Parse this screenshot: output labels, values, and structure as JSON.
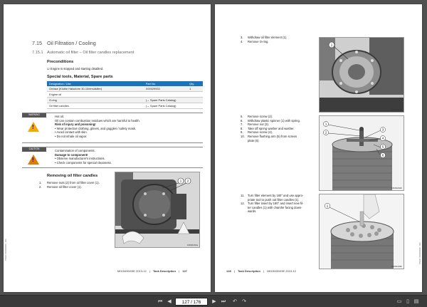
{
  "left_page": {
    "section_number": "7.15",
    "section_title": "Oil Filtration / Cooling",
    "subsection_number": "7.15.1",
    "subsection_title": "Automatic oil filter – Oil filter candles replacement",
    "preconditions_heading": "Preconditions",
    "precondition_item": "☑ Engine is stopped and starting disabled.",
    "tools_heading": "Special tools, Material, Spare parts",
    "tools_table": {
      "headers": [
        "Designation / Use",
        "Part No.",
        "Qty."
      ],
      "rows": [
        [
          "Grease (Kluthe Hakuform 30-10/emulsifier)",
          "X00029933",
          "1"
        ],
        [
          "Engine oil",
          "",
          ""
        ],
        [
          "O-ring",
          "(→ Spare Parts Catalog)",
          ""
        ],
        [
          "Oil filter candles",
          "(→ Spare Parts Catalog)",
          ""
        ]
      ]
    },
    "warning": {
      "tag": "WARNING",
      "lines": [
        "Hot oil.",
        "Oil can contain combustion residues which are harmful to health.",
        "Risk of injury and poisoning!",
        "• Wear protective clothing, gloves, and goggles / safety mask.",
        "• Avoid contact with skin.",
        "• Do not inhale oil vapor."
      ]
    },
    "caution": {
      "tag": "CAUTION",
      "lines": [
        "Contamination of components.",
        "Damage to component!",
        "• Observe manufacturer's instructions.",
        "• Check components for special cleanness."
      ]
    },
    "removing_heading": "Removing oil filter candles",
    "steps": [
      {
        "num": "1.",
        "text": "Remove nuts (2) from oil filter cover (1)."
      },
      {
        "num": "2.",
        "text": "Remove oil filter cover (1)."
      }
    ],
    "photo_callouts": [
      "1",
      "2"
    ],
    "photo_id": "16000191a",
    "footer_doc": "M015490/03E 2013-12",
    "footer_section": "Task Description",
    "footer_page": "127",
    "side_text": "TIM-ID: 0000000000 - 004"
  },
  "right_page": {
    "steps_a": [
      {
        "num": "3.",
        "text": "Withdraw oil filter element (1)."
      },
      {
        "num": "4.",
        "text": "Remove O-ring."
      }
    ],
    "photo_a_callouts": [
      "1"
    ],
    "photo_a_id": "16000192b",
    "steps_b": [
      {
        "num": "5.",
        "text": "Remove screw (2)."
      },
      {
        "num": "6.",
        "text": "Withdraw plastic spinner (1) with spring."
      },
      {
        "num": "7.",
        "text": "Remove nut (3)."
      },
      {
        "num": "8.",
        "text": "Take off spring washer and washer."
      },
      {
        "num": "9.",
        "text": "Remove screw (4)."
      },
      {
        "num": "10.",
        "text": "Remove flushing arm (5) from screen"
      },
      {
        "num": "",
        "text": "plate (6)."
      }
    ],
    "photo_b_callouts": [
      "1",
      "2",
      "3",
      "4",
      "5",
      "6"
    ],
    "photo_b_id": "16000262b",
    "steps_c": [
      {
        "num": "11.",
        "text": "Turn filter element by 180° and use appro-"
      },
      {
        "num": "",
        "text": "priate tool to push out filter candles (1)."
      },
      {
        "num": "12.",
        "text": "Turn filter insert by 180° and insert new fil-"
      },
      {
        "num": "",
        "text": "ter candles (1) with chamfer facing down-"
      },
      {
        "num": "",
        "text": "wards."
      }
    ],
    "photo_c_callouts": [
      "1"
    ],
    "photo_c_id": "16000193b",
    "footer_page": "128",
    "footer_section": "Task Description",
    "footer_doc": "M015490/03E 2013-12",
    "side_text": "TIM-ID: 0000000000 - 004"
  },
  "toolbar": {
    "current_page": "127 / 176",
    "colors": {
      "warning": "#f2a900",
      "caution": "#e07a00",
      "table_header": "#1b74b8",
      "tag_bg": "#555555"
    }
  }
}
